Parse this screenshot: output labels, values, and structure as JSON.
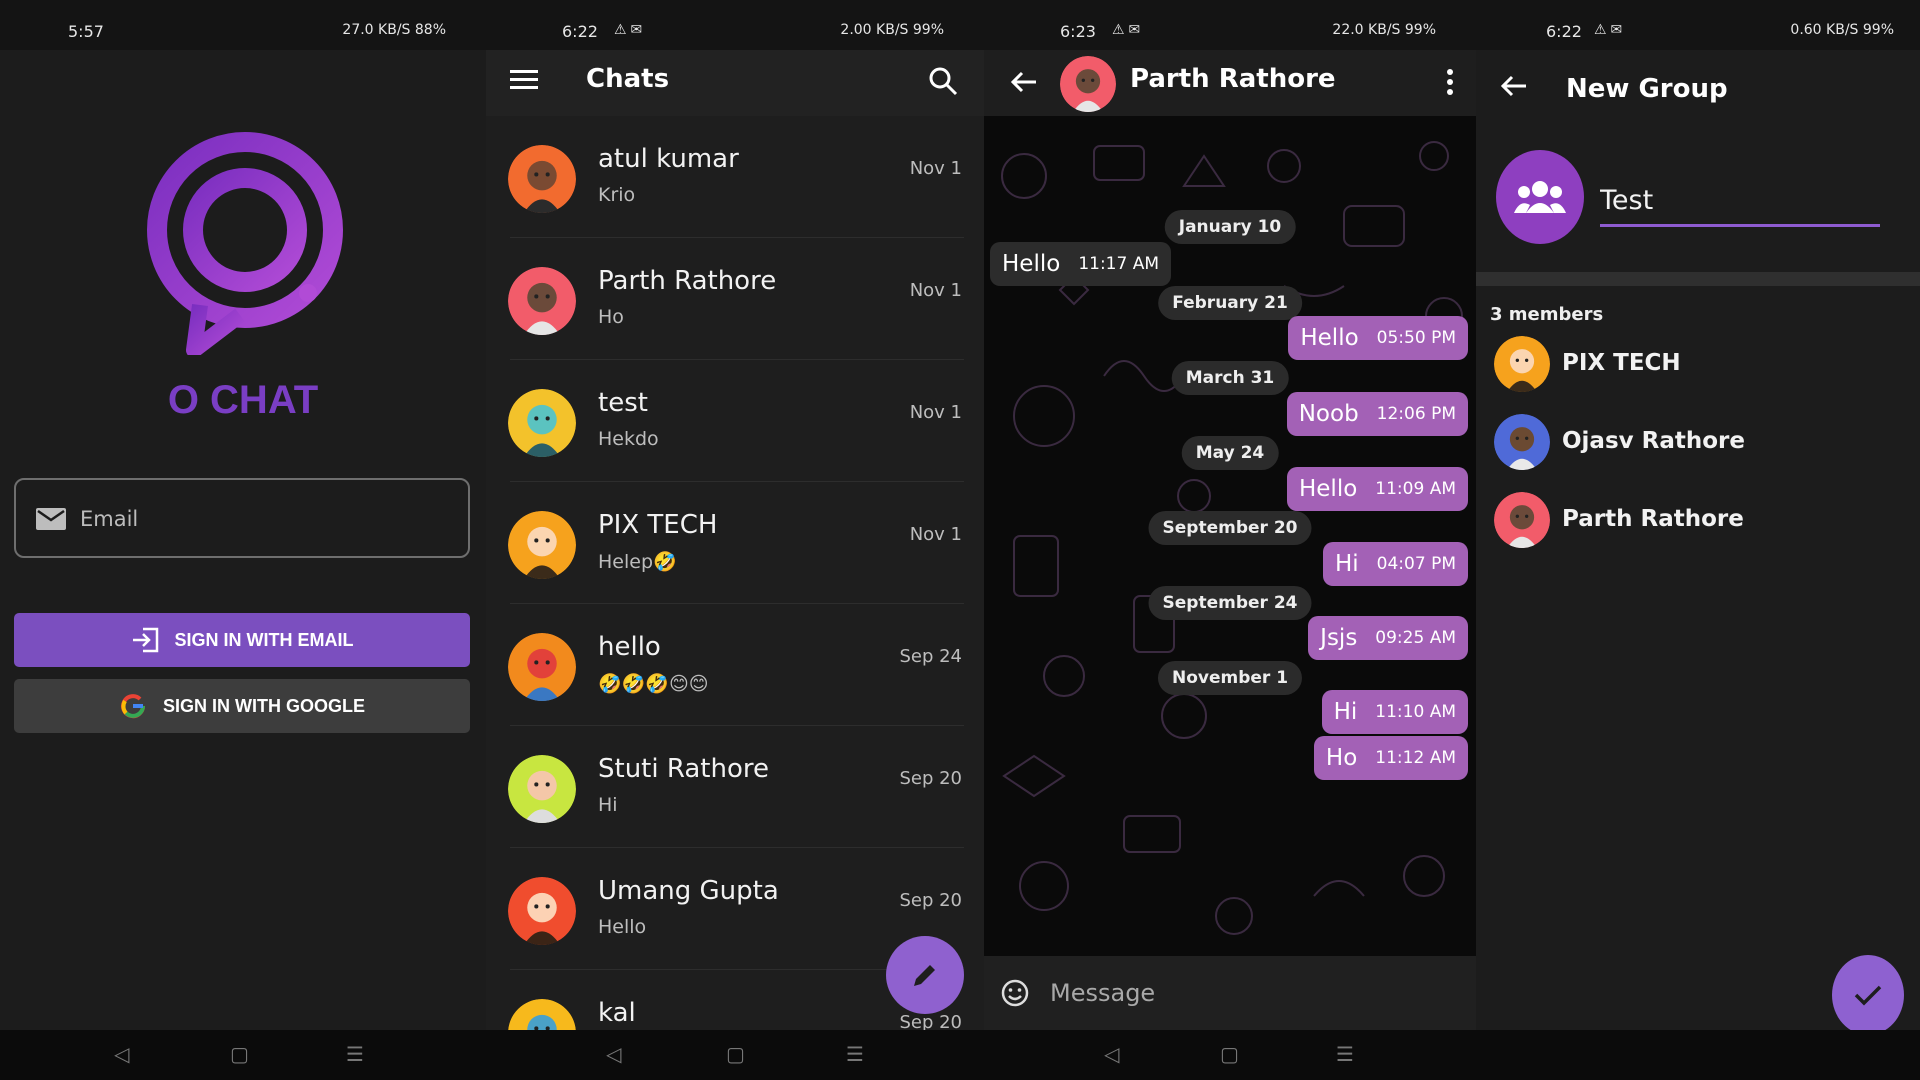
{
  "colors": {
    "accent": "#7b4fbf",
    "bubble_out": "#a361b6",
    "fab": "#8f61cf",
    "logo": "#8e3fc0"
  },
  "login": {
    "status_time": "5:57",
    "status_right": "27.0 KB/S  88%",
    "app_name": "O CHAT",
    "email_placeholder": "Email",
    "sign_in_email": "SIGN IN WITH EMAIL",
    "sign_in_google": "SIGN IN WITH GOOGLE"
  },
  "chats": {
    "status_time": "6:22",
    "status_right": "2.00 KB/S  99%",
    "title": "Chats",
    "items": [
      {
        "name": "atul kumar",
        "last": "Krio",
        "date": "Nov 1",
        "avatar": "avatar-orange"
      },
      {
        "name": "Parth Rathore",
        "last": "Ho",
        "date": "Nov 1",
        "avatar": "avatar-pink"
      },
      {
        "name": "test",
        "last": "Hekdo",
        "date": "Nov 1",
        "avatar": "avatar-robot"
      },
      {
        "name": "PIX TECH",
        "last": "Helep🤣",
        "date": "Nov 1",
        "avatar": "avatar-orange-boy"
      },
      {
        "name": "hello",
        "last": "🤣🤣🤣😊😊",
        "date": "Sep 24",
        "avatar": "avatar-mask"
      },
      {
        "name": "Stuti Rathore",
        "last": "Hi",
        "date": "Sep 20",
        "avatar": "avatar-green"
      },
      {
        "name": "Umang Gupta",
        "last": "Hello",
        "date": "Sep 20",
        "avatar": "avatar-red"
      },
      {
        "name": "kal",
        "last": "",
        "date": "Sep 20",
        "avatar": "avatar-yellow"
      }
    ]
  },
  "conversation": {
    "status_time": "6:23",
    "status_right": "22.0 KB/S  99%",
    "contact_name": "Parth Rathore",
    "messages": [
      {
        "kind": "date",
        "text": "January 10"
      },
      {
        "kind": "in",
        "text": "Hello",
        "time": "11:17 AM"
      },
      {
        "kind": "date",
        "text": "February 21"
      },
      {
        "kind": "out",
        "text": "Hello",
        "time": "05:50 PM"
      },
      {
        "kind": "date",
        "text": "March 31"
      },
      {
        "kind": "out",
        "text": "Noob",
        "time": "12:06 PM"
      },
      {
        "kind": "date",
        "text": "May 24"
      },
      {
        "kind": "out",
        "text": "Hello",
        "time": "11:09 AM"
      },
      {
        "kind": "date",
        "text": "September 20"
      },
      {
        "kind": "out",
        "text": "Hi",
        "time": "04:07 PM"
      },
      {
        "kind": "date",
        "text": "September 24"
      },
      {
        "kind": "out",
        "text": "Jsjs",
        "time": "09:25 AM"
      },
      {
        "kind": "date",
        "text": "November 1"
      },
      {
        "kind": "out",
        "text": "Hi",
        "time": "11:10 AM"
      },
      {
        "kind": "out",
        "text": "Ho",
        "time": "11:12 AM"
      }
    ],
    "message_placeholder": "Message"
  },
  "new_group": {
    "status_time": "6:22",
    "status_right": "0.60 KB/S  99%",
    "title": "New Group",
    "group_name": "Test",
    "members_label": "3 members",
    "members": [
      {
        "name": "PIX TECH",
        "avatar": "avatar-orange-boy"
      },
      {
        "name": "Ojasv Rathore",
        "avatar": "avatar-blue"
      },
      {
        "name": "Parth Rathore",
        "avatar": "avatar-pink"
      }
    ]
  }
}
